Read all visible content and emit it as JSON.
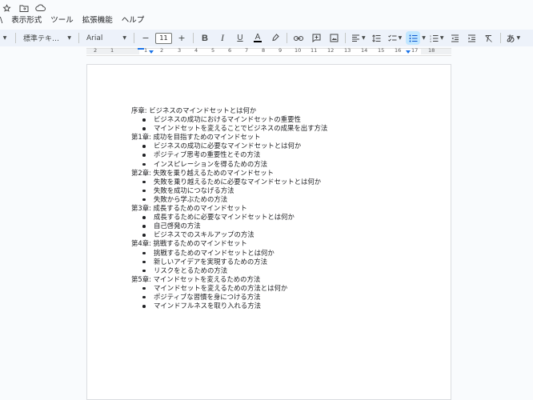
{
  "menubar": {
    "items": [
      "\\",
      "表示形式",
      "ツール",
      "拡張機能",
      "ヘルプ"
    ]
  },
  "title_icons": [
    "star-icon",
    "folder-move-icon",
    "cloud-status-icon"
  ],
  "toolbar": {
    "style_select": "標準テキ…",
    "font_select": "Arial",
    "font_size": "11",
    "font_size_minus": "−",
    "font_size_plus": "+",
    "bold": "B",
    "italic": "I",
    "underline": "U",
    "text_color": "A",
    "input_tools": "あ"
  },
  "ruler": {
    "labels": [
      "2",
      "1",
      "1",
      "2",
      "3",
      "4",
      "5",
      "6",
      "7",
      "8",
      "9",
      "10",
      "11",
      "12",
      "13",
      "14",
      "15",
      "16",
      "17",
      "18"
    ]
  },
  "document": {
    "lines": [
      {
        "type": "chapter",
        "text": "序章: ビジネスのマインドセットとは何か"
      },
      {
        "type": "bullet",
        "text": "ビジネスの成功におけるマインドセットの重要性"
      },
      {
        "type": "bullet",
        "text": "マインドセットを変えることでビジネスの成果を出す方法"
      },
      {
        "type": "chapter",
        "text": "第1章: 成功を目指すためのマインドセット"
      },
      {
        "type": "bullet",
        "text": "ビジネスの成功に必要なマインドセットとは何か"
      },
      {
        "type": "bullet",
        "text": "ポジティブ思考の重要性とその方法"
      },
      {
        "type": "bullet",
        "text": "インスピレーションを得るための方法"
      },
      {
        "type": "chapter",
        "text": "第2章: 失敗を乗り越えるためのマインドセット"
      },
      {
        "type": "bullet",
        "text": "失敗を乗り越えるために必要なマインドセットとは何か"
      },
      {
        "type": "bullet",
        "text": "失敗を成功につなげる方法"
      },
      {
        "type": "bullet",
        "text": "失敗から学ぶための方法"
      },
      {
        "type": "chapter",
        "text": "第3章: 成長するためのマインドセット"
      },
      {
        "type": "bullet",
        "text": "成長するために必要なマインドセットとは何か"
      },
      {
        "type": "bullet",
        "text": "自己啓発の方法"
      },
      {
        "type": "bullet",
        "text": "ビジネスでのスキルアップの方法"
      },
      {
        "type": "chapter",
        "text": "第4章: 挑戦するためのマインドセット"
      },
      {
        "type": "bullet",
        "text": "挑戦するためのマインドセットとは何か"
      },
      {
        "type": "bullet",
        "text": "新しいアイデアを実現するための方法"
      },
      {
        "type": "bullet",
        "text": "リスクをとるための方法"
      },
      {
        "type": "chapter",
        "text": "第5章: マインドセットを変えるための方法"
      },
      {
        "type": "bullet",
        "text": "マインドセットを変えるための方法とは何か"
      },
      {
        "type": "bullet",
        "text": "ポジティブな習慣を身につける方法"
      },
      {
        "type": "bullet",
        "text": "マインドフルネスを取り入れる方法"
      }
    ]
  },
  "colors": {
    "toolbar_bg": "#edf2fa",
    "page_bg": "#f9fbfd",
    "accent": "#1a73e8",
    "active_button": "#c2e7ff"
  }
}
